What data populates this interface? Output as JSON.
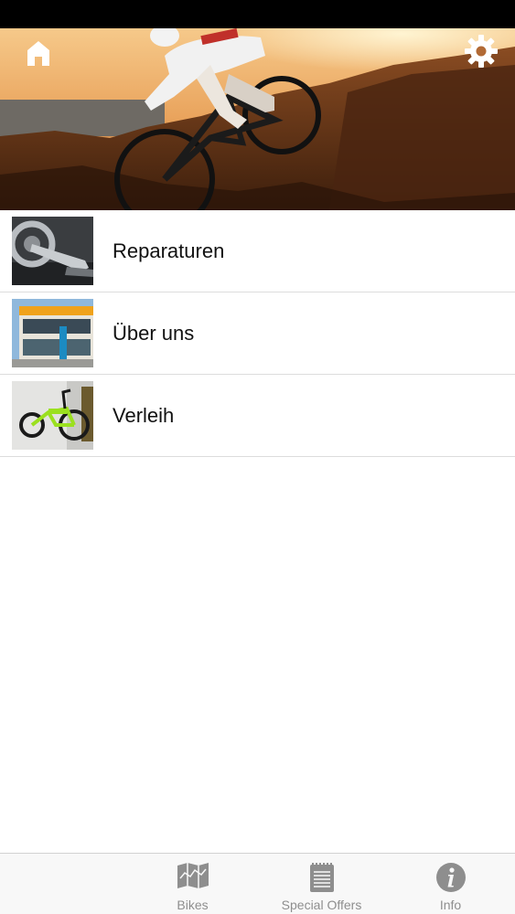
{
  "colors": {
    "tab_inactive": "#8e8e8e",
    "separator": "#dcdcdc"
  },
  "header": {
    "home_icon": "home-icon",
    "settings_icon": "gear-icon"
  },
  "menu": {
    "items": [
      {
        "label": "Reparaturen",
        "icon": "bike-crank-thumbnail"
      },
      {
        "label": "Über uns",
        "icon": "shop-building-thumbnail"
      },
      {
        "label": "Verleih",
        "icon": "ebike-thumbnail"
      }
    ]
  },
  "tabbar": {
    "tabs": [
      {
        "label": "Bikes",
        "icon": "map-icon"
      },
      {
        "label": "Special Offers",
        "icon": "notepad-icon"
      },
      {
        "label": "Info",
        "icon": "info-icon"
      }
    ]
  }
}
